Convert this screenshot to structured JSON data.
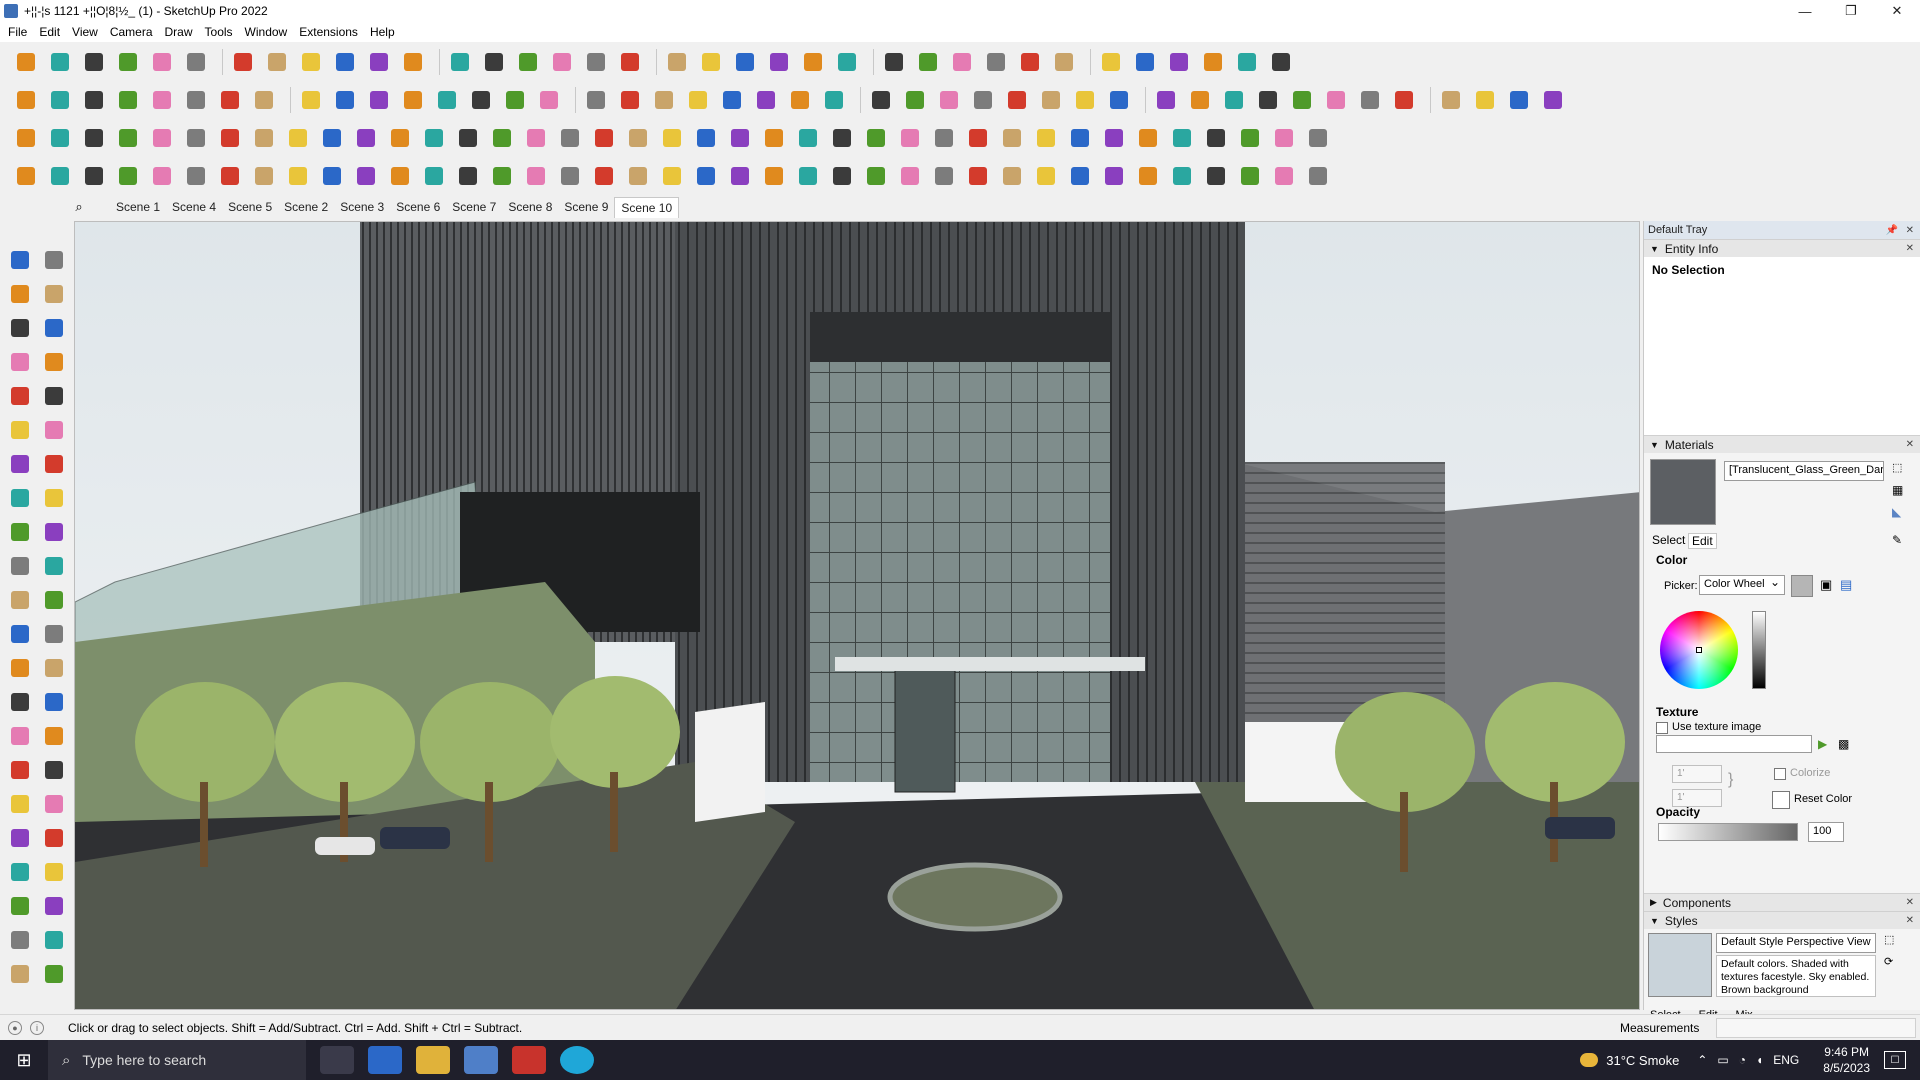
{
  "window": {
    "title": "+¦¦-¦s 1121 +¦¦О¦8¦½_ (1) - SketchUp Pro 2022",
    "controls": [
      "—",
      "❐",
      "✕"
    ]
  },
  "menu": [
    "File",
    "Edit",
    "View",
    "Camera",
    "Draw",
    "Tools",
    "Window",
    "Extensions",
    "Help"
  ],
  "scenes": {
    "tabs": [
      "Scene 1",
      "Scene 4",
      "Scene 5",
      "Scene 2",
      "Scene 3",
      "Scene 6",
      "Scene 7",
      "Scene 8",
      "Scene 9",
      "Scene 10"
    ],
    "active": "Scene 10"
  },
  "tray": {
    "title": "Default Tray",
    "entity_info": {
      "header": "Entity Info",
      "value": "No Selection"
    },
    "materials": {
      "header": "Materials",
      "material_name": "[Translucent_Glass_Green_Dark]",
      "tabs": [
        "Select",
        "Edit"
      ],
      "color_section": "Color",
      "picker_label": "Picker:",
      "picker_value": "Color Wheel",
      "texture_section": "Texture",
      "use_texture_label": "Use texture image",
      "width_value": "1'",
      "height_value": "1'",
      "colorize_label": "Colorize",
      "reset_color_label": "Reset Color",
      "opacity_section": "Opacity",
      "opacity_value": "100"
    },
    "components": {
      "header": "Components"
    },
    "styles": {
      "header": "Styles",
      "style_name": "Default Style Perspective View",
      "description": "Default colors. Shaded with textures facestyle. Sky enabled. Brown background",
      "tabs": [
        "Select",
        "Edit",
        "Mix"
      ]
    }
  },
  "status": {
    "hint": "Click or drag to select objects. Shift = Add/Subtract. Ctrl = Add. Shift + Ctrl = Subtract.",
    "measurements_label": "Measurements"
  },
  "taskbar": {
    "search_placeholder": "Type here to search",
    "weather": "31°C  Smoke",
    "language": "ENG",
    "time": "9:46 PM",
    "date": "8/5/2023"
  }
}
